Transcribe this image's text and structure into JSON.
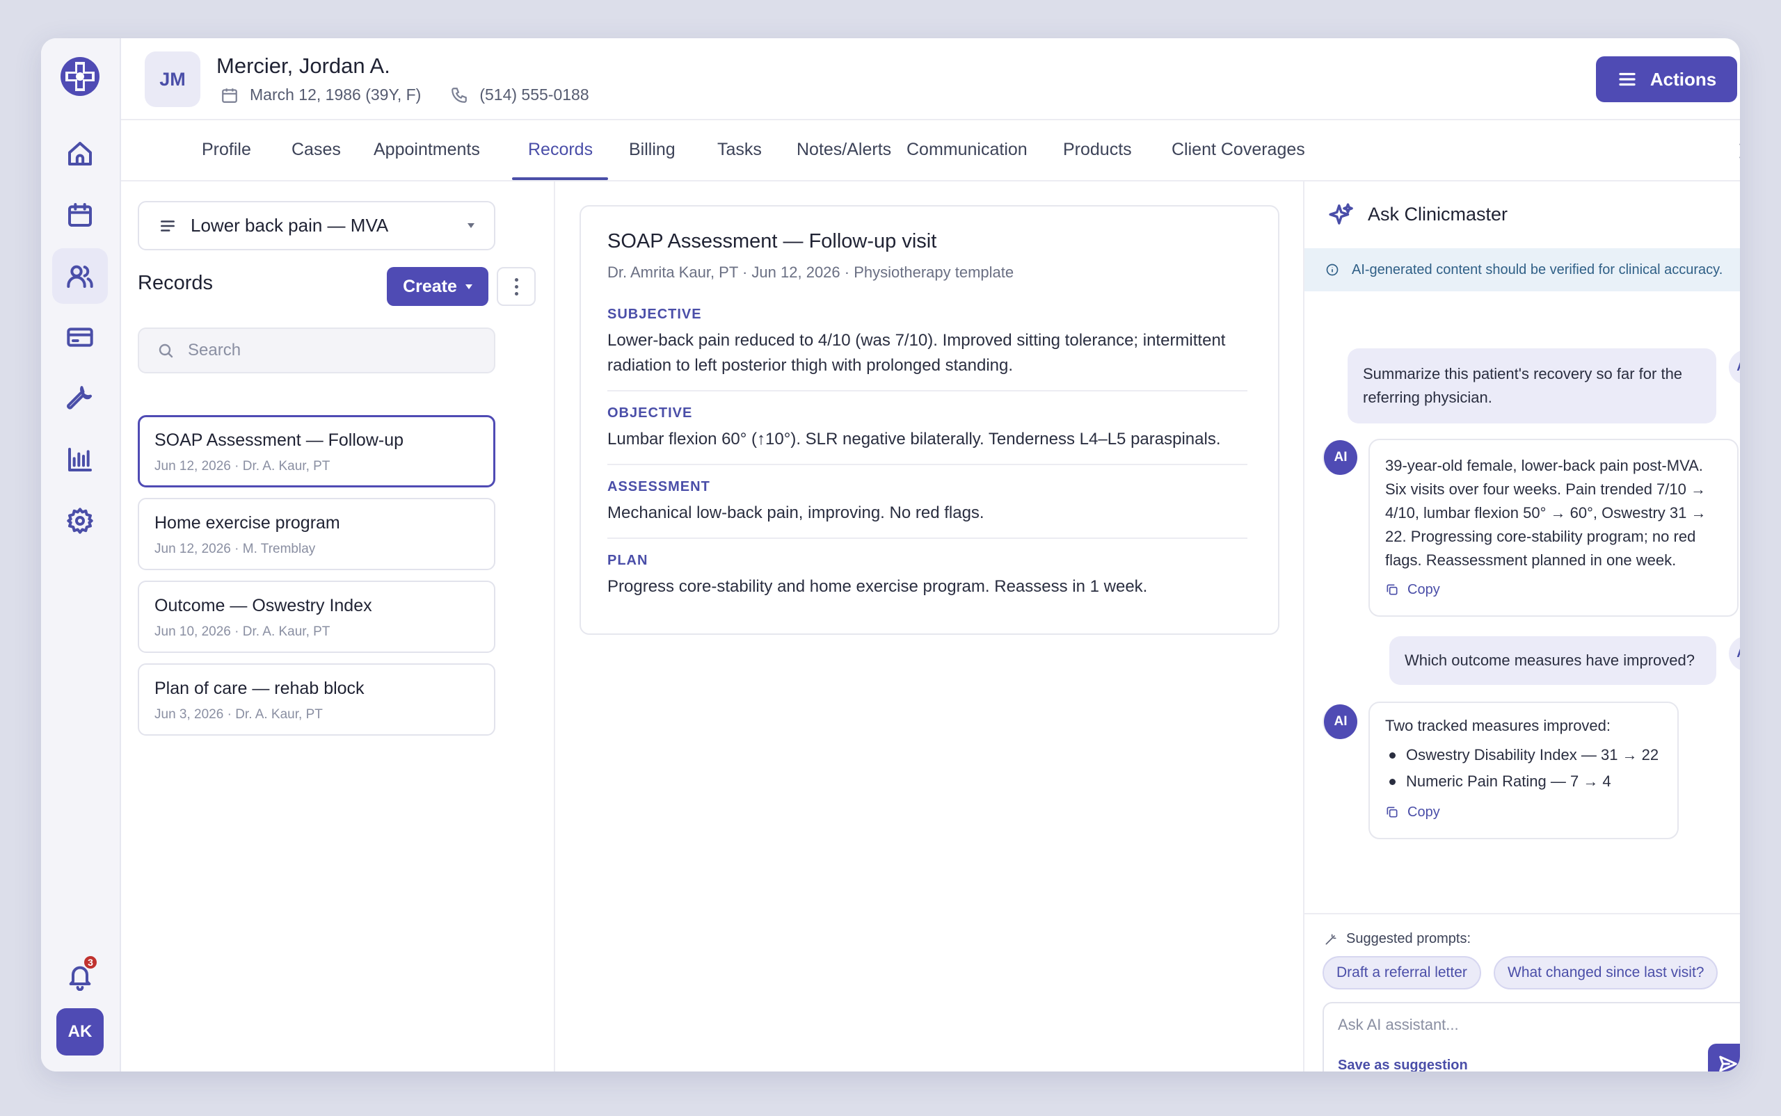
{
  "colors": {
    "accent": "#4f4bb4",
    "notice_bg": "#e9f1f8",
    "badge": "#c0322f"
  },
  "rail": {
    "items": [
      {
        "icon": "home-icon"
      },
      {
        "icon": "calendar-icon"
      },
      {
        "icon": "users-icon",
        "active": true
      },
      {
        "icon": "credit-card-icon"
      },
      {
        "icon": "wrench-icon"
      },
      {
        "icon": "bar-chart-icon"
      },
      {
        "icon": "settings-icon"
      }
    ],
    "notification_count": "3",
    "user_initials": "AK"
  },
  "patient": {
    "initials": "JM",
    "name": "Mercier, Jordan A.",
    "dob": "March 12, 1986 (39Y, F)",
    "phone": "(514) 555-0188"
  },
  "header": {
    "actions_label": "Actions"
  },
  "tabs": [
    {
      "label": "Profile"
    },
    {
      "label": "Cases"
    },
    {
      "label": "Appointments"
    },
    {
      "label": "Records",
      "active": true
    },
    {
      "label": "Billing"
    },
    {
      "label": "Tasks"
    },
    {
      "label": "Notes/Alerts"
    },
    {
      "label": "Communication"
    },
    {
      "label": "Products"
    },
    {
      "label": "Client Coverages"
    }
  ],
  "records": {
    "case": "Lower back pain — MVA",
    "title": "Records",
    "create_label": "Create",
    "search_placeholder": "Search",
    "items": [
      {
        "title": "SOAP Assessment — Follow-up",
        "sub": "Jun 12, 2026 · Dr. A. Kaur, PT",
        "active": true
      },
      {
        "title": "Home exercise program",
        "sub": "Jun 12, 2026 · M. Tremblay"
      },
      {
        "title": "Outcome — Oswestry Index",
        "sub": "Jun 10, 2026 · Dr. A. Kaur, PT"
      },
      {
        "title": "Plan of care — rehab block",
        "sub": "Jun 3, 2026 · Dr. A. Kaur, PT"
      }
    ]
  },
  "soap": {
    "title": "SOAP Assessment — Follow-up visit",
    "meta": "Dr. Amrita Kaur, PT · Jun 12, 2026 · Physiotherapy template",
    "sections": [
      {
        "label": "SUBJECTIVE",
        "body": "Lower-back pain reduced to 4/10 (was 7/10). Improved sitting tolerance; intermittent radiation to left posterior thigh with prolonged standing."
      },
      {
        "label": "OBJECTIVE",
        "body": "Lumbar flexion 60° (↑10°). SLR negative bilaterally. Tenderness L4–L5 paraspinals."
      },
      {
        "label": "ASSESSMENT",
        "body": "Mechanical low-back pain, improving. No red flags."
      },
      {
        "label": "PLAN",
        "body": "Progress core-stability and home exercise program. Reassess in 1 week."
      }
    ]
  },
  "ai": {
    "title": "Ask Clinicmaster",
    "notice": "AI-generated content should be verified for clinical accuracy.",
    "user_initials": "AK",
    "ai_initials": "AI",
    "copy_label": "Copy",
    "messages": {
      "q1": "Summarize this patient's recovery so far for the referring physician.",
      "a1": "39-year-old female, lower-back pain post-MVA. Six visits over four weeks. Pain trended 7/10 → 4/10, lumbar flexion 50° → 60°, Oswestry 31 → 22. Progressing core-stability program; no red flags. Reassessment planned in one week.",
      "q2": "Which outcome measures have improved?",
      "a2_intro": "Two tracked measures improved:",
      "a2_bullets": [
        "Oswestry Disability Index — 31 → 22",
        "Numeric Pain Rating — 7 → 4"
      ]
    },
    "suggested_label": "Suggested prompts:",
    "suggestions": [
      "Draft a referral letter",
      "What changed since last visit?"
    ],
    "input_placeholder": "Ask AI assistant...",
    "save_suggestion": "Save as suggestion"
  }
}
